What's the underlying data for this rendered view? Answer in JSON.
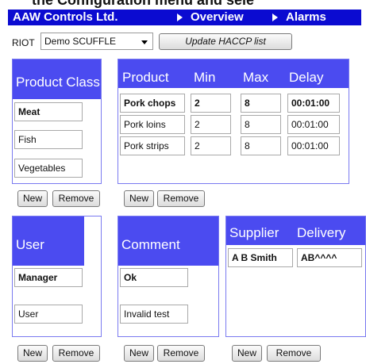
{
  "window": {
    "cut_title": "the Configuration menu and sele",
    "brand": "AAW Controls Ltd.",
    "nav": [
      "Overview",
      "Alarms"
    ]
  },
  "toolbar": {
    "riot_label": "RIOT",
    "riot_selected": "Demo SCUFFLE",
    "update_button": "Update HACCP list"
  },
  "product_class": {
    "header": "Product Class",
    "items": [
      "Meat",
      "Fish",
      "Vegetables"
    ],
    "new_label": "New",
    "remove_label": "Remove"
  },
  "products": {
    "headers": [
      "Product",
      "Min",
      "Max",
      "Delay"
    ],
    "rows": [
      {
        "product": "Pork chops",
        "min": "2",
        "max": "8",
        "delay": "00:01:00"
      },
      {
        "product": "Pork loins",
        "min": "2",
        "max": "8",
        "delay": "00:01:00"
      },
      {
        "product": "Pork strips",
        "min": "2",
        "max": "8",
        "delay": "00:01:00"
      }
    ],
    "new_label": "New",
    "remove_label": "Remove"
  },
  "user": {
    "header": "User",
    "items": [
      "Manager",
      "User"
    ],
    "new_label": "New",
    "remove_label": "Remove"
  },
  "comment": {
    "header": "Comment",
    "items": [
      "Ok",
      "Invalid test"
    ],
    "new_label": "New",
    "remove_label": "Remove"
  },
  "supplier": {
    "headers": [
      "Supplier",
      "Delivery"
    ],
    "rows": [
      {
        "supplier": "A B Smith",
        "delivery": "AB^^^^"
      }
    ],
    "new_label": "New",
    "remove_label": "Remove"
  },
  "colors": {
    "header_bar": "#0b0bd1",
    "panel_header": "#4b4bf0",
    "panel_border": "#7a7af0"
  }
}
